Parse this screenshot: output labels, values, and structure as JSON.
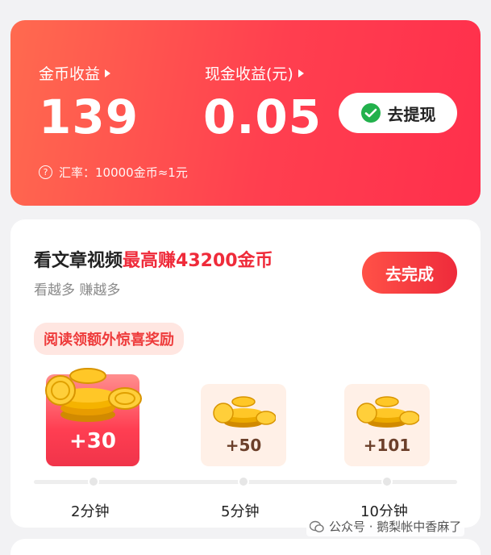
{
  "earnings": {
    "coin_label": "金币收益",
    "coin_value": "139",
    "cash_label": "现金收益(元)",
    "cash_value": "0.05",
    "withdraw_label": "去提现",
    "rate_text": "汇率：10000金币≈1元",
    "rate_icon": "?"
  },
  "task": {
    "title_main": "看文章视频",
    "title_highlight": "最高赚43200金币",
    "subtitle": "看越多 赚越多",
    "go_label": "去完成",
    "bonus_tag": "阅读领额外惊喜奖励",
    "rewards": [
      {
        "value": "+30",
        "time": "2分钟"
      },
      {
        "value": "+50",
        "time": "5分钟"
      },
      {
        "value": "+101",
        "time": "10分钟"
      }
    ]
  },
  "watermark": {
    "text": "公众号 · 鹅梨帐中香麻了"
  },
  "colors": {
    "accent_red": "#ef2b3a",
    "wechat_green": "#22b14c",
    "coin_gold": "#f5b300"
  }
}
